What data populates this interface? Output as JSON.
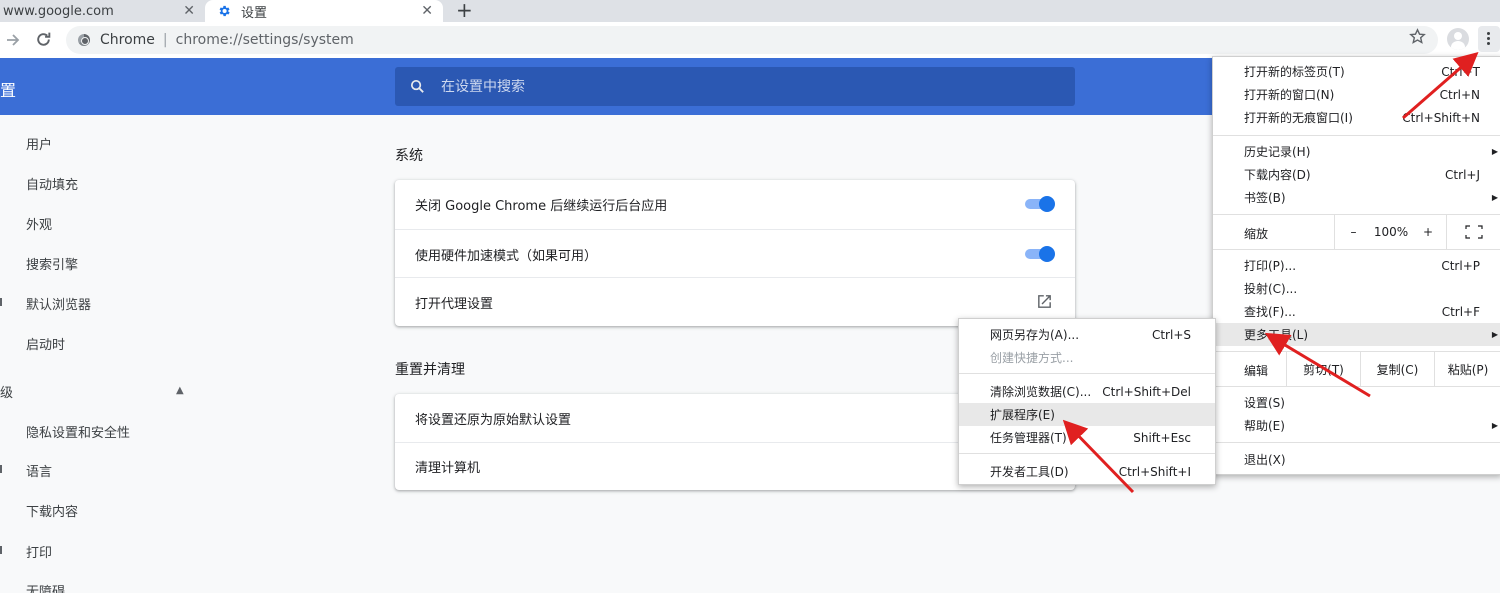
{
  "tabs": [
    {
      "title": "www.google.com",
      "close": "✕"
    },
    {
      "title": "设置",
      "close": "✕"
    }
  ],
  "new_tab": "+",
  "toolbar": {
    "site_label": "Chrome",
    "separator": "|",
    "url": "chrome://settings/system"
  },
  "header": {
    "title": "置",
    "search_placeholder": "在设置中搜索"
  },
  "sidebar": {
    "items": [
      "用户",
      "自动填充",
      "外观",
      "搜索引擎",
      "默认浏览器",
      "启动时"
    ],
    "advanced_label": "级",
    "advanced_items": [
      "隐私设置和安全性",
      "语言",
      "下载内容",
      "打印",
      "无障碍"
    ]
  },
  "sections": [
    {
      "title": "系统",
      "rows": [
        {
          "label": "关闭 Google Chrome 后继续运行后台应用",
          "control": "toggle",
          "on": true
        },
        {
          "label": "使用硬件加速模式（如果可用）",
          "control": "toggle",
          "on": true
        },
        {
          "label": "打开代理设置",
          "control": "external-link-icon"
        }
      ]
    },
    {
      "title": "重置并清理",
      "rows": [
        {
          "label": "将设置还原为原始默认设置"
        },
        {
          "label": "清理计算机"
        }
      ]
    }
  ],
  "main_menu": {
    "group1": [
      {
        "label": "打开新的标签页(T)",
        "shortcut": "Ctrl+T"
      },
      {
        "label": "打开新的窗口(N)",
        "shortcut": "Ctrl+N"
      },
      {
        "label": "打开新的无痕窗口(I)",
        "shortcut": "Ctrl+Shift+N"
      }
    ],
    "group2": [
      {
        "label": "历史记录(H)",
        "shortcut": "",
        "submenu": true
      },
      {
        "label": "下载内容(D)",
        "shortcut": "Ctrl+J"
      },
      {
        "label": "书签(B)",
        "shortcut": "",
        "submenu": true
      }
    ],
    "zoom": {
      "label": "缩放",
      "minus": "–",
      "value": "100%",
      "plus": "+"
    },
    "group3": [
      {
        "label": "打印(P)...",
        "shortcut": "Ctrl+P"
      },
      {
        "label": "投射(C)...",
        "shortcut": ""
      },
      {
        "label": "查找(F)...",
        "shortcut": "Ctrl+F"
      },
      {
        "label": "更多工具(L)",
        "shortcut": "",
        "submenu": true
      }
    ],
    "edit": {
      "label": "编辑",
      "cut": "剪切(T)",
      "copy": "复制(C)",
      "paste": "粘贴(P)"
    },
    "group4": [
      {
        "label": "设置(S)",
        "shortcut": ""
      },
      {
        "label": "帮助(E)",
        "shortcut": "",
        "submenu": true
      }
    ],
    "group5": [
      {
        "label": "退出(X)",
        "shortcut": ""
      }
    ],
    "submenu_arrow": "▶"
  },
  "more_tools_menu": {
    "group1": [
      {
        "label": "网页另存为(A)...",
        "shortcut": "Ctrl+S"
      },
      {
        "label": "创建快捷方式...",
        "shortcut": "",
        "disabled": true
      }
    ],
    "group2": [
      {
        "label": "清除浏览数据(C)...",
        "shortcut": "Ctrl+Shift+Del"
      },
      {
        "label": "扩展程序(E)",
        "shortcut": ""
      },
      {
        "label": "任务管理器(T)",
        "shortcut": "Shift+Esc"
      }
    ],
    "group3": [
      {
        "label": "开发者工具(D)",
        "shortcut": "Ctrl+Shift+I"
      }
    ]
  },
  "colors": {
    "header_blue": "#3b6ed6",
    "search_blue": "#2b58b3",
    "toggle_on": "#1a73e8",
    "annotation_arrow": "#e02020"
  }
}
